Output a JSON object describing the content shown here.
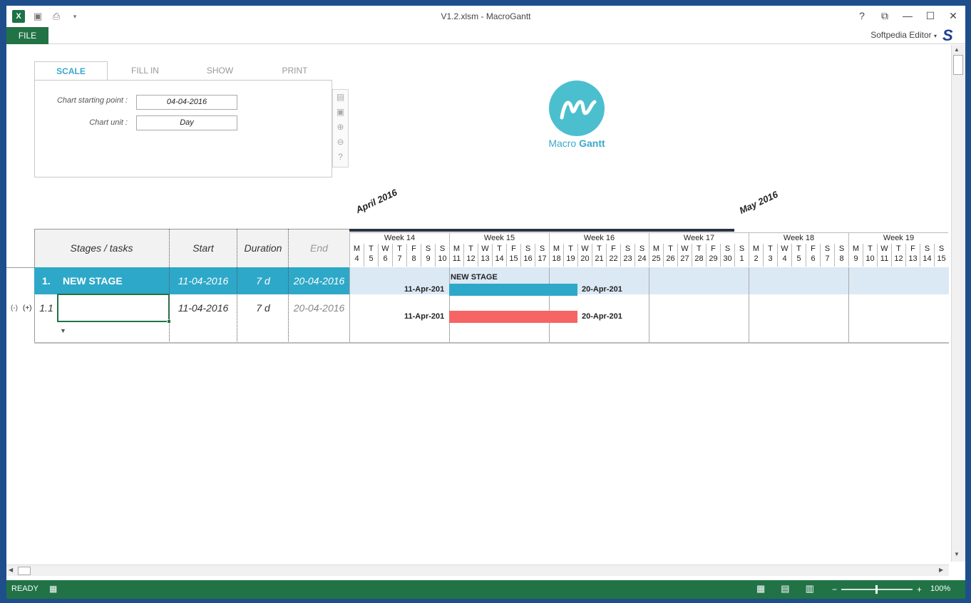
{
  "window": {
    "title": "V1.2.xlsm - MacroGantt",
    "user": "Softpedia Editor",
    "file_tab": "FILE",
    "excel_icon": "X",
    "help": "?",
    "restore": "⧉",
    "minimize": "—",
    "maximize": "☐",
    "close": "✕",
    "s_logo": "S"
  },
  "panel": {
    "tabs": [
      "SCALE",
      "FILL IN",
      "SHOW",
      "PRINT"
    ],
    "active_tab": "SCALE",
    "start_label": "Chart starting point :",
    "start_value": "04-04-2016",
    "unit_label": "Chart unit :",
    "unit_value": "Day"
  },
  "logo": {
    "macro": "Macro",
    "gantt": "Gantt"
  },
  "months": [
    "April 2016",
    "May 2016"
  ],
  "table": {
    "headers": {
      "stages": "Stages / tasks",
      "start": "Start",
      "duration": "Duration",
      "end": "End"
    },
    "stage": {
      "num": "1.",
      "name": "NEW STAGE",
      "start": "11-04-2016",
      "duration": "7 d",
      "end": "20-04-2016"
    },
    "task": {
      "num": "1.1",
      "start": "11-04-2016",
      "duration": "7 d",
      "end": "20-04-2016",
      "collapse": "(-)",
      "expand": "(+)",
      "arrow": "▼"
    }
  },
  "gantt": {
    "weeks": [
      "Week  14",
      "Week  15",
      "Week  16",
      "Week  17",
      "Week  18",
      "Week  19"
    ],
    "day_letters": [
      "M",
      "T",
      "W",
      "T",
      "F",
      "S",
      "S"
    ],
    "day_numbers": [
      "4",
      "5",
      "6",
      "7",
      "8",
      "9",
      "10",
      "11",
      "12",
      "13",
      "14",
      "15",
      "16",
      "17",
      "18",
      "19",
      "20",
      "21",
      "22",
      "23",
      "24",
      "25",
      "26",
      "27",
      "28",
      "29",
      "30",
      "1",
      "2",
      "3",
      "4",
      "5",
      "6",
      "7",
      "8",
      "9",
      "10",
      "11",
      "12",
      "13",
      "14",
      "15"
    ],
    "stage_bar": {
      "label": "NEW STAGE",
      "start_label": "11-Apr-201",
      "end_label": "20-Apr-201",
      "color": "#2ea8c8"
    },
    "task_bar": {
      "start_label": "11-Apr-201",
      "end_label": "20-Apr-201",
      "color": "#f76464"
    }
  },
  "status": {
    "ready": "READY",
    "zoom": "100%"
  }
}
